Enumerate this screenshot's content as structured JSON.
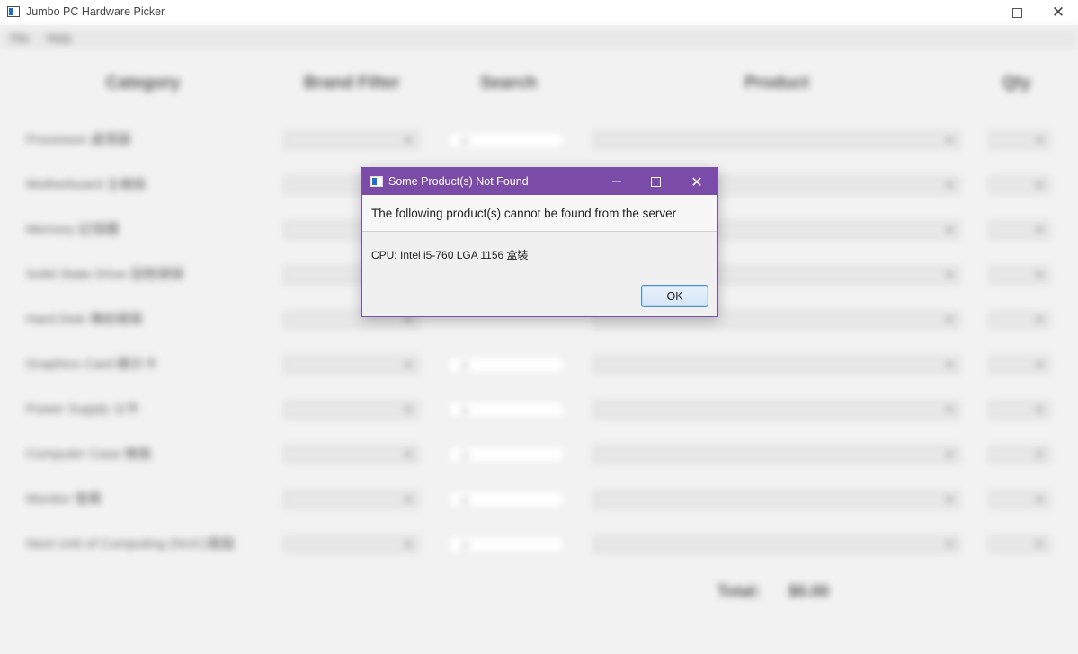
{
  "window": {
    "title": "Jumbo PC Hardware Picker",
    "minimize_icon": "minimize-icon",
    "maximize_icon": "maximize-icon",
    "close_symbol": "✕"
  },
  "background": {
    "menu": [
      "File",
      "Help"
    ],
    "columns": [
      "Category",
      "Brand Filter",
      "Search",
      "Product",
      "Qty"
    ],
    "rows": [
      {
        "label": "Processor 處理器",
        "product": "",
        "qty": "",
        "has_search": true
      },
      {
        "label": "Motherboard 主機板",
        "product": "",
        "qty": "",
        "has_search": false
      },
      {
        "label": "Memory 記憶體",
        "product": "",
        "qty": "",
        "has_search": false
      },
      {
        "label": "Solid State Drive 固態硬碟",
        "product": "",
        "qty": "",
        "has_search": false
      },
      {
        "label": "Hard Disk 傳統硬碟",
        "product": "",
        "qty": "",
        "has_search": false
      },
      {
        "label": "Graphics Card 顯示卡",
        "product": "",
        "qty": "",
        "has_search": true
      },
      {
        "label": "Power Supply 火牛",
        "product": "",
        "qty": "",
        "has_search": true
      },
      {
        "label": "Computer Case 機箱",
        "product": "",
        "qty": "",
        "has_search": true
      },
      {
        "label": "Monitor 螢幕",
        "product": "",
        "qty": "",
        "has_search": true
      },
      {
        "label": "Next Unit of Computing (NUC)電腦",
        "product": "",
        "qty": "",
        "has_search": true
      }
    ],
    "total_label": "Total:",
    "total_value": "$0.00"
  },
  "dialog": {
    "title": "Some Product(s) Not Found",
    "header": "The following product(s) cannot be found from the server",
    "content": "CPU: Intel i5-760 LGA 1156 盒裝",
    "ok_label": "OK",
    "close_symbol": "✕",
    "accent_color": "#7a4ba7"
  }
}
